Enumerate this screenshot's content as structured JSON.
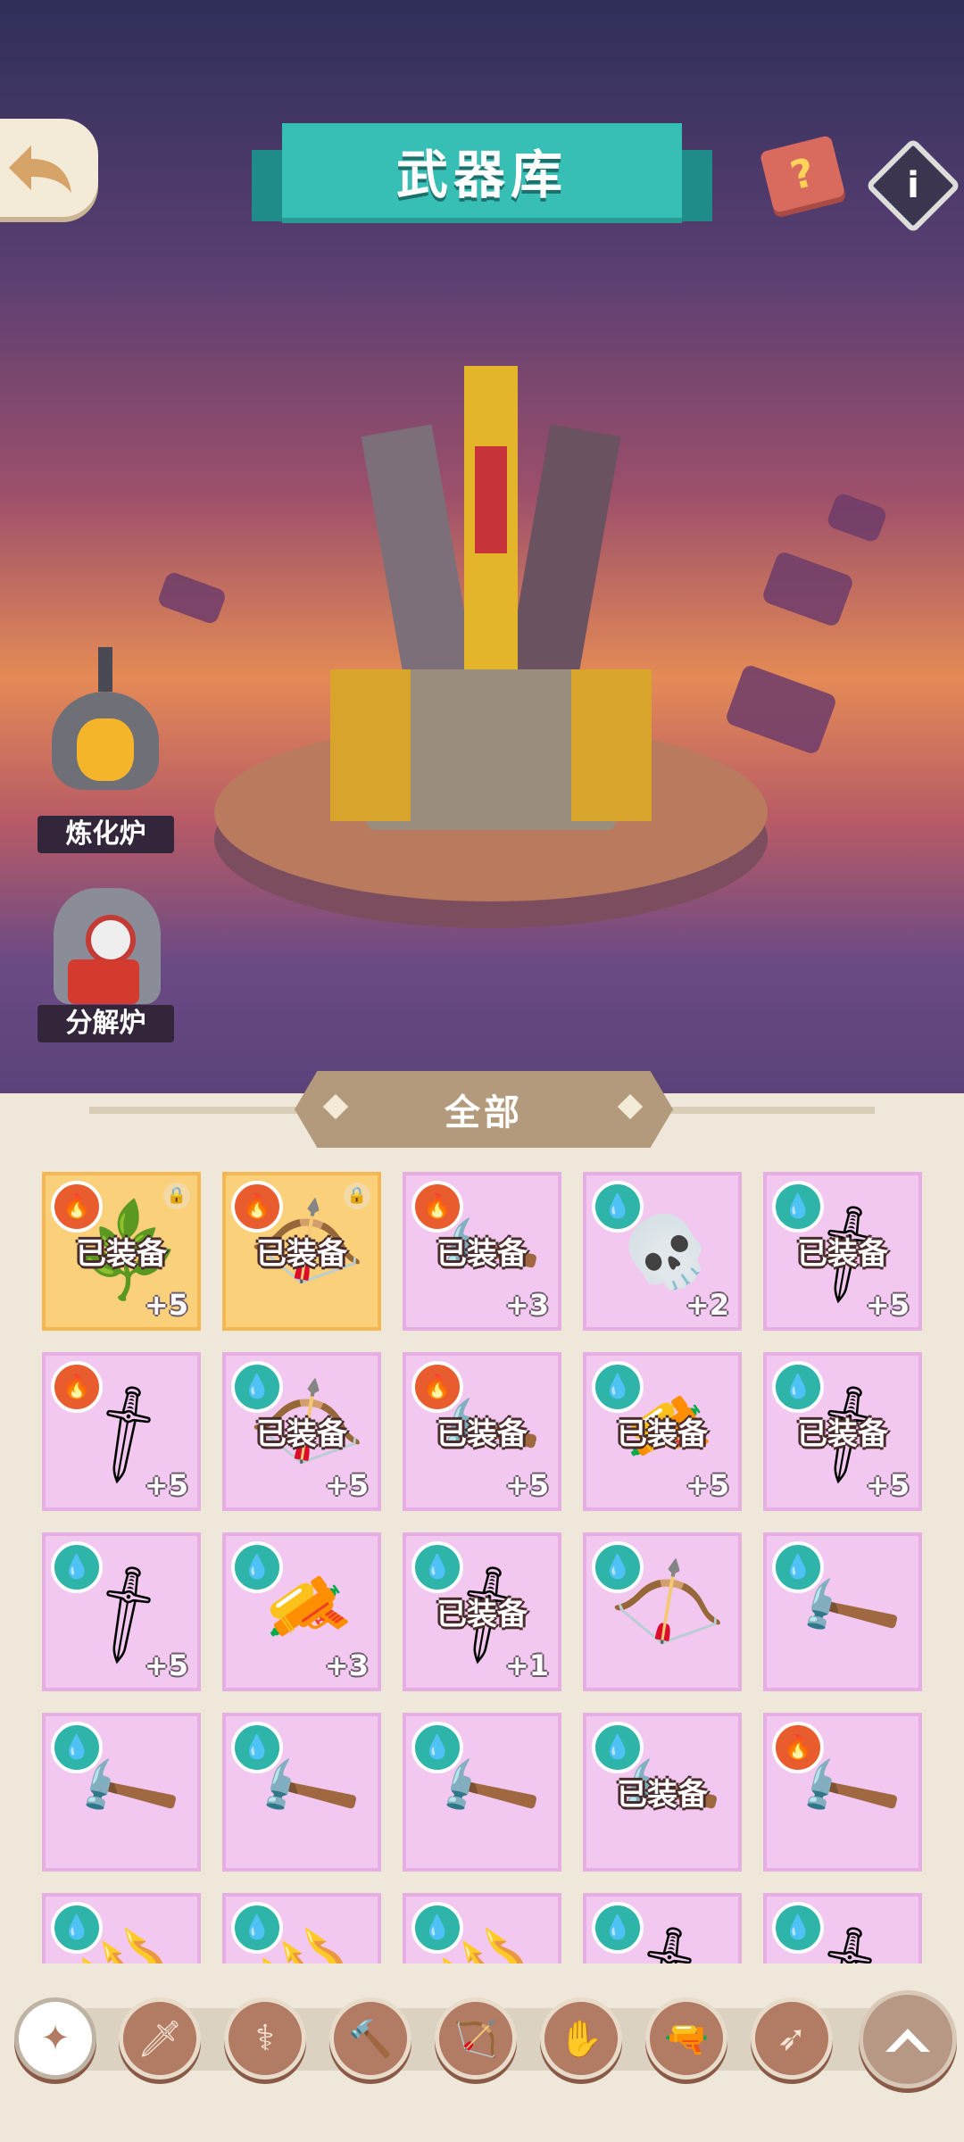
{
  "header": {
    "title": "武器库"
  },
  "icons": {
    "back": "back-arrow-icon",
    "book": "help-book-icon",
    "info": "info-icon"
  },
  "side_buttons": {
    "furnace_label": "炼化炉",
    "decompose_label": "分解炉"
  },
  "filter": {
    "active_label": "全部"
  },
  "inventory": {
    "equipped_text": "已装备",
    "items": [
      {
        "element": "fire",
        "bg": "gold",
        "equipped": true,
        "locked": true,
        "level": "+5",
        "weapon": "vine-staff"
      },
      {
        "element": "fire",
        "bg": "gold",
        "equipped": true,
        "locked": true,
        "level": "",
        "weapon": "vine-bow"
      },
      {
        "element": "fire",
        "bg": "pink",
        "equipped": true,
        "locked": false,
        "level": "+3",
        "weapon": "crystal-hammer"
      },
      {
        "element": "water",
        "bg": "pink",
        "equipped": false,
        "locked": false,
        "level": "+2",
        "weapon": "skull-staff"
      },
      {
        "element": "water",
        "bg": "pink",
        "equipped": true,
        "locked": false,
        "level": "+5",
        "weapon": "ice-sword"
      },
      {
        "element": "fire",
        "bg": "pink",
        "equipped": false,
        "locked": false,
        "level": "+5",
        "weapon": "ice-sword"
      },
      {
        "element": "water",
        "bg": "pink",
        "equipped": true,
        "locked": false,
        "level": "+5",
        "weapon": "bone-bow"
      },
      {
        "element": "fire",
        "bg": "pink",
        "equipped": true,
        "locked": false,
        "level": "+5",
        "weapon": "gem-hammer"
      },
      {
        "element": "water",
        "bg": "pink",
        "equipped": true,
        "locked": false,
        "level": "+5",
        "weapon": "gold-cannon"
      },
      {
        "element": "water",
        "bg": "pink",
        "equipped": true,
        "locked": false,
        "level": "+5",
        "weapon": "gold-sword"
      },
      {
        "element": "water",
        "bg": "pink",
        "equipped": false,
        "locked": false,
        "level": "+5",
        "weapon": "gold-sword"
      },
      {
        "element": "water",
        "bg": "pink",
        "equipped": false,
        "locked": false,
        "level": "+3",
        "weapon": "gold-cannon"
      },
      {
        "element": "water",
        "bg": "pink",
        "equipped": true,
        "locked": false,
        "level": "+1",
        "weapon": "ice-sword"
      },
      {
        "element": "water",
        "bg": "pink",
        "equipped": false,
        "locked": false,
        "level": "",
        "weapon": "bone-bow"
      },
      {
        "element": "water",
        "bg": "pink",
        "equipped": false,
        "locked": false,
        "level": "",
        "weapon": "gem-hammer"
      },
      {
        "element": "water",
        "bg": "pink",
        "equipped": false,
        "locked": false,
        "level": "",
        "weapon": "gem-hammer"
      },
      {
        "element": "water",
        "bg": "pink",
        "equipped": false,
        "locked": false,
        "level": "",
        "weapon": "gem-hammer"
      },
      {
        "element": "water",
        "bg": "pink",
        "equipped": false,
        "locked": false,
        "level": "",
        "weapon": "gem-hammer"
      },
      {
        "element": "water",
        "bg": "pink",
        "equipped": true,
        "locked": false,
        "level": "",
        "weapon": "steel-hammer"
      },
      {
        "element": "fire",
        "bg": "pink",
        "equipped": false,
        "locked": false,
        "level": "",
        "weapon": "steel-hammer"
      },
      {
        "element": "water",
        "bg": "pink",
        "equipped": false,
        "locked": false,
        "level": "",
        "weapon": "spear"
      },
      {
        "element": "water",
        "bg": "pink",
        "equipped": false,
        "locked": false,
        "level": "",
        "weapon": "spear"
      },
      {
        "element": "water",
        "bg": "pink",
        "equipped": false,
        "locked": false,
        "level": "",
        "weapon": "spear"
      },
      {
        "element": "water",
        "bg": "pink",
        "equipped": false,
        "locked": false,
        "level": "",
        "weapon": "gold-sword"
      },
      {
        "element": "water",
        "bg": "pink",
        "equipped": false,
        "locked": false,
        "level": "",
        "weapon": "gold-sword"
      }
    ]
  },
  "bottom_nav": {
    "items": [
      {
        "name": "all-category-icon",
        "glyph": "✦",
        "active": true
      },
      {
        "name": "sword-category-icon",
        "glyph": "🗡",
        "active": false
      },
      {
        "name": "staff-category-icon",
        "glyph": "⚕",
        "active": false
      },
      {
        "name": "hammer-category-icon",
        "glyph": "🔨",
        "active": false
      },
      {
        "name": "bow-category-icon",
        "glyph": "🏹",
        "active": false
      },
      {
        "name": "claw-category-icon",
        "glyph": "✋",
        "active": false
      },
      {
        "name": "gun-category-icon",
        "glyph": "🔫",
        "active": false
      },
      {
        "name": "spear-category-icon",
        "glyph": "➶",
        "active": false
      }
    ],
    "collapse_icon": "chevron-up-icon"
  }
}
